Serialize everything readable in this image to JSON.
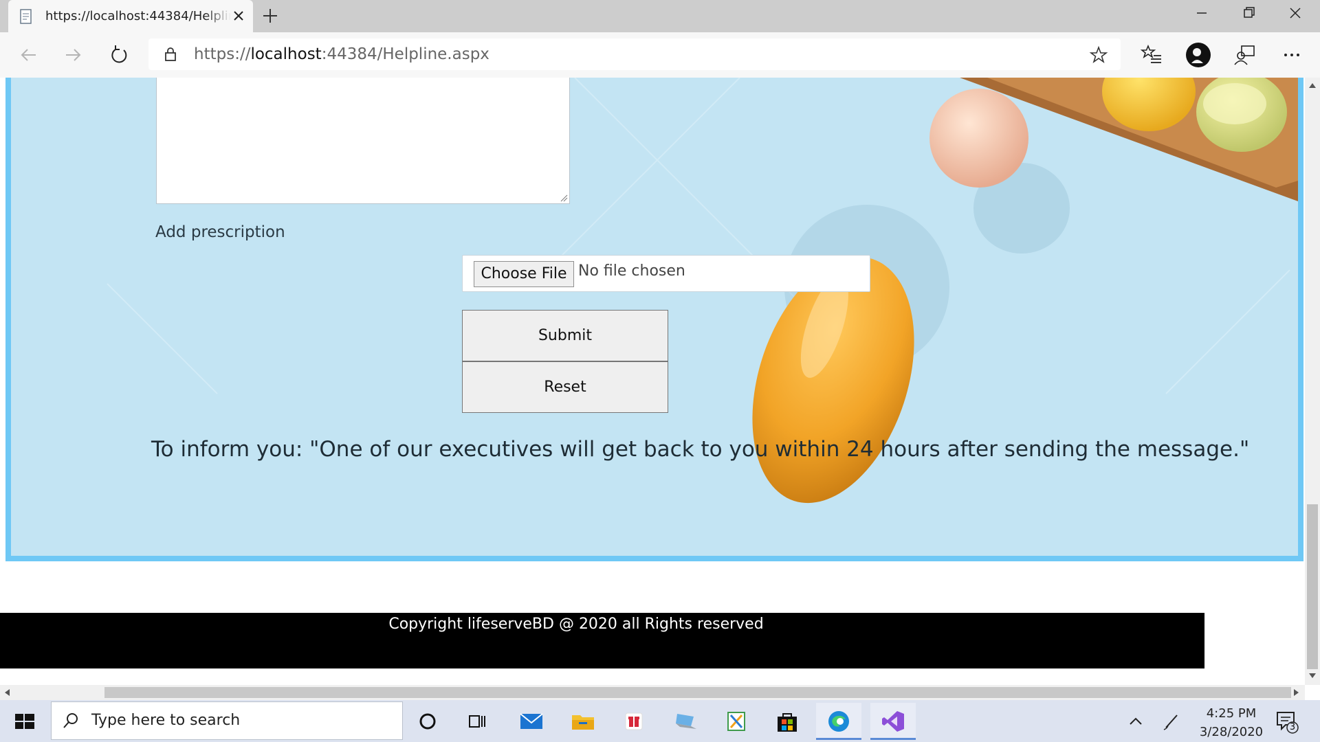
{
  "browser": {
    "tab_title": "https://localhost:44384/Helpline.aspx",
    "url_scheme": "https://",
    "url_host": "localhost",
    "url_rest": ":44384/Helpline.aspx"
  },
  "form": {
    "prescription_label": "Add prescription",
    "file_button_label": "Choose File",
    "file_status": "No file chosen",
    "submit_label": "Submit",
    "reset_label": "Reset"
  },
  "notice": "To inform you: \"One of our executives will get back to you within 24 hours after sending the message.\"",
  "footer": {
    "copyright": "Copyright lifeserveBD @ 2020 all Rights reserved"
  },
  "taskbar": {
    "search_placeholder": "Type here to search",
    "time": "4:25 PM",
    "date": "3/28/2020",
    "notification_count": "3",
    "apps": [
      "cortana-icon",
      "task-view-icon",
      "mail-icon",
      "file-explorer-icon",
      "gift-icon",
      "laptop-icon",
      "snip-icon",
      "store-icon",
      "edge-icon",
      "visual-studio-icon"
    ]
  },
  "colors": {
    "hero_bg": "#c3e4f3",
    "hero_border": "#6fc8f5",
    "footer_bg": "#000000",
    "pill_orange": "#f2a427"
  }
}
